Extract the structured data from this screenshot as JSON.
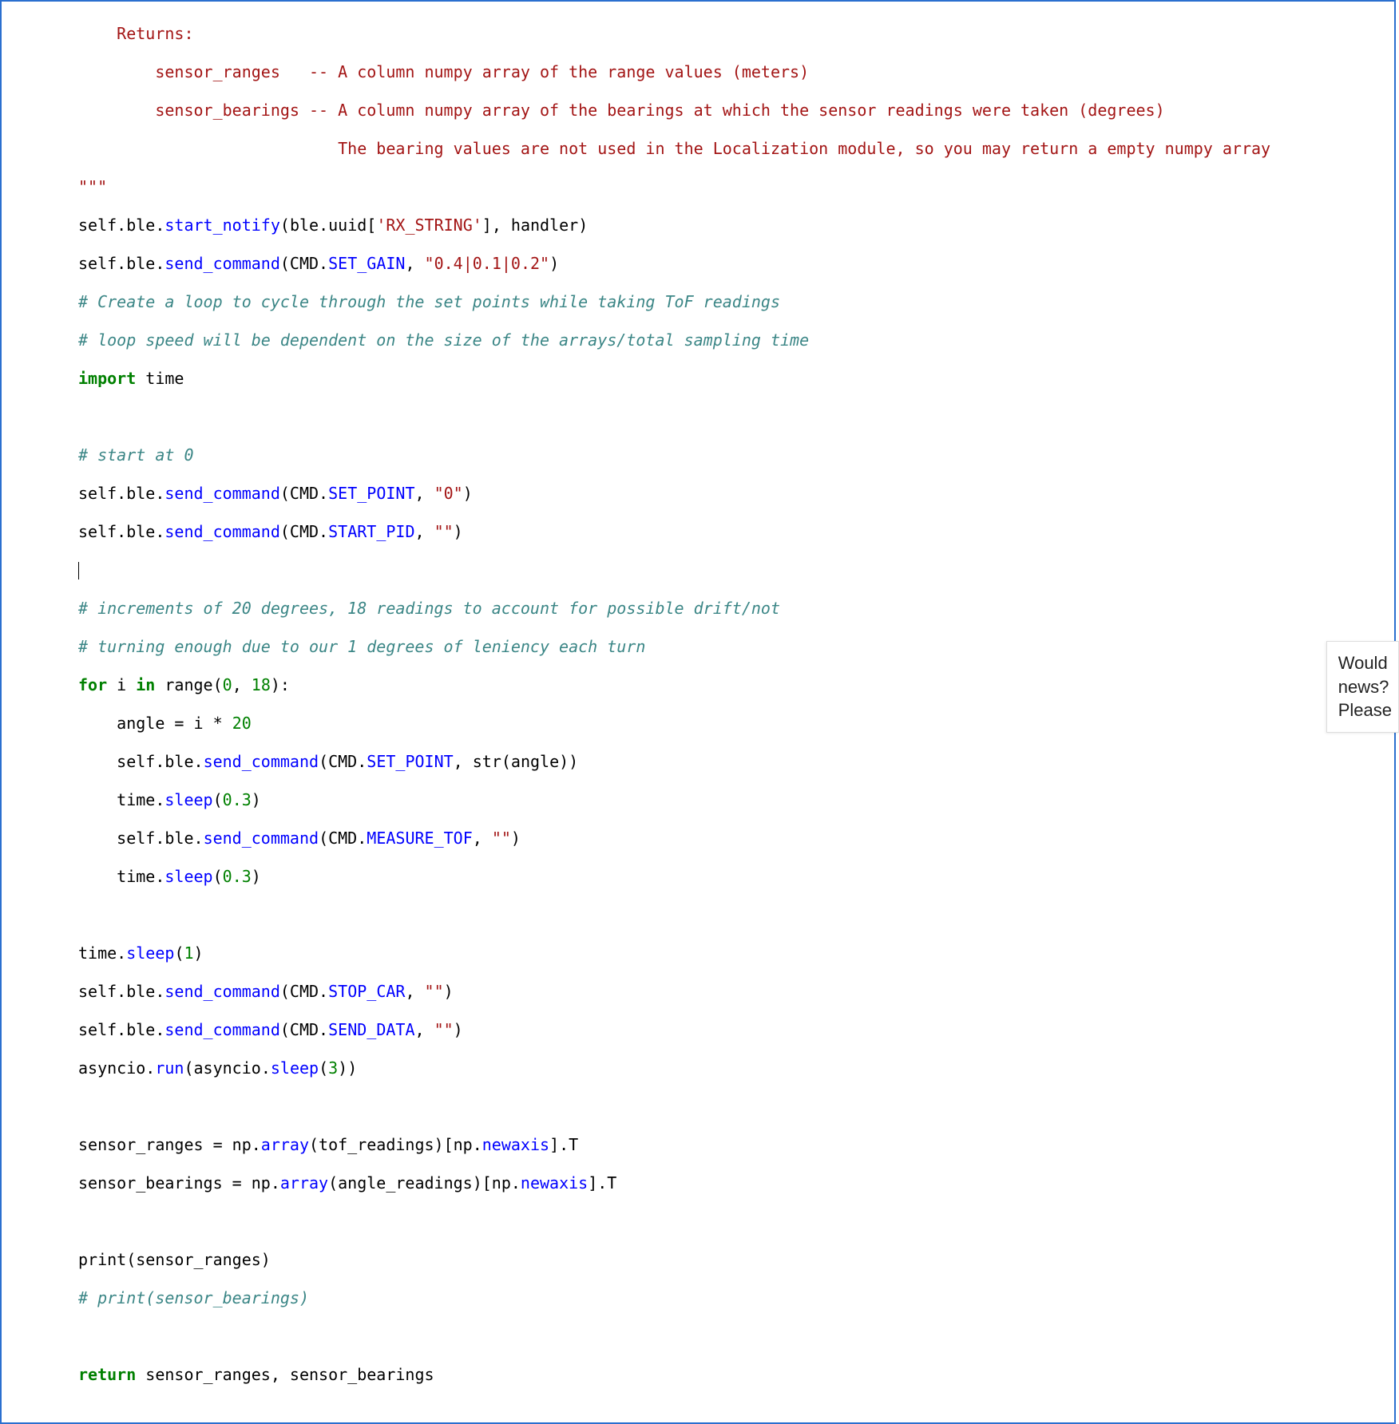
{
  "docstring": {
    "returns_label": "    Returns:",
    "ret1": "        sensor_ranges   -- A column numpy array of the range values (meters)",
    "ret2": "        sensor_bearings -- A column numpy array of the bearings at which the sensor readings were taken (degrees)",
    "ret3": "                           The bearing values are not used in the Localization module, so you may return a empty numpy array",
    "end": "\"\"\""
  },
  "code": {
    "l1_self": "self",
    "l1_ble": "ble",
    "l1_fn": "start_notify",
    "l1_arg_ble": "ble",
    "l1_uuid": "uuid",
    "l1_key": "'RX_STRING'",
    "l1_handler": ", handler)",
    "l2_fn": "send_command",
    "l2_cmd": "SET_GAIN",
    "l2_val": "\"0.4|0.1|0.2\"",
    "c1": "# Create a loop to cycle through the set points while taking ToF readings",
    "c2": "# loop speed will be dependent on the size of the arrays/total sampling time",
    "kw_import": "import",
    "mod_time": " time",
    "c3": "# start at 0",
    "cmd_set_point": "SET_POINT",
    "val_zero": "\"0\"",
    "cmd_start_pid": "START_PID",
    "val_empty": "\"\"",
    "c4": "# increments of 20 degrees, 18 readings to account for possible drift/not",
    "c5": "# turning enough due to our 1 degrees of leniency each turn",
    "kw_for": "for",
    "for_mid": " i ",
    "kw_in": "in",
    "range_call": " range(",
    "num0": "0",
    "comma": ", ",
    "num18": "18",
    "close_colon": "):",
    "angle_lhs": "    angle ",
    "eq": "=",
    "angle_rhs_i": " i ",
    "star": "*",
    "sp20": " ",
    "num20": "20",
    "indent": "    ",
    "str_fn": "str",
    "str_arg": "(angle))",
    "sleep": "sleep",
    "num03": "0.3",
    "cmd_measure": "MEASURE_TOF",
    "num1": "1",
    "cmd_stop": "STOP_CAR",
    "cmd_send": "SEND_DATA",
    "asyncio": "asyncio",
    "run": "run",
    "num3": "3",
    "sr": "sensor_ranges ",
    "sb": "sensor_bearings ",
    "np": " np",
    "array": "array",
    "tof": "(tof_readings)",
    "angles": "(angle_readings)",
    "newaxis": "newaxis",
    "dotT": ".T",
    "print": "print",
    "pr_arg1": "(sensor_ranges)",
    "c6": "# print(sensor_bearings)",
    "kw_return": "return",
    "ret_tail": " sensor_ranges, sensor_bearings"
  },
  "popup": {
    "l1": "Would",
    "l2": "news?",
    "l3": "Please"
  }
}
